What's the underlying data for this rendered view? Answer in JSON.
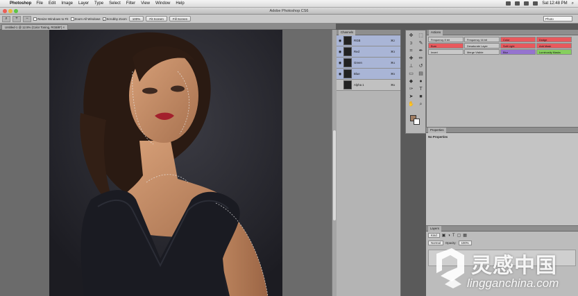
{
  "menubar": {
    "app_name": "Photoshop",
    "items": [
      "File",
      "Edit",
      "Image",
      "Layer",
      "Type",
      "Select",
      "Filter",
      "View",
      "Window",
      "Help"
    ],
    "clock": "Sat 12:48 PM"
  },
  "window": {
    "title": "Adobe Photoshop CS6"
  },
  "options_bar": {
    "check_resize": "Resize Windows to Fit",
    "check_zoom_all": "Zoom All Windows",
    "check_scrubby": "Scrubby Zoom",
    "btn_100": "100%",
    "btn_fit": "Fit Screen",
    "btn_fill": "Fill Screen",
    "workspace": "Photo"
  },
  "document": {
    "tab_label": "Untitled-1 @ 12.5% (Color Toning, RGB/8*) ×"
  },
  "channels": {
    "tab": "Channels",
    "rows": [
      {
        "name": "RGB",
        "key": "⌘2"
      },
      {
        "name": "Red",
        "key": "⌘3"
      },
      {
        "name": "Green",
        "key": "⌘4"
      },
      {
        "name": "Blue",
        "key": "⌘5"
      },
      {
        "name": "Alpha 1",
        "key": "⌘6"
      }
    ]
  },
  "actions": {
    "tab": "Actions",
    "buttons": [
      {
        "label": "Frequency 8 bit",
        "color": "#c9c9c9"
      },
      {
        "label": "Frequency 16 bit",
        "color": "#c9c9c9"
      },
      {
        "label": "Color",
        "color": "#e8595d"
      },
      {
        "label": "Dodge",
        "color": "#e8595d"
      },
      {
        "label": "Burn",
        "color": "#e8595d"
      },
      {
        "label": "Desaturate Layer",
        "color": "#c9c9c9"
      },
      {
        "label": "Soft Light",
        "color": "#e8595d"
      },
      {
        "label": "Add Mask",
        "color": "#e8595d"
      },
      {
        "label": "Invert",
        "color": "#c9c9c9"
      },
      {
        "label": "Merge Visible",
        "color": "#c9c9c9"
      },
      {
        "label": "Blur",
        "color": "#9573cf"
      },
      {
        "label": "Luminosity Masks",
        "color": "#86cf5e"
      }
    ]
  },
  "properties": {
    "tab": "Properties",
    "empty_text": "No Properties"
  },
  "layers": {
    "tab": "Layers",
    "kind": "Kind",
    "blend": "Normal",
    "opacity_label": "Opacity:",
    "opacity": "100%"
  },
  "watermark": {
    "main": "灵感中国",
    "sub": "lingganchina.com"
  }
}
